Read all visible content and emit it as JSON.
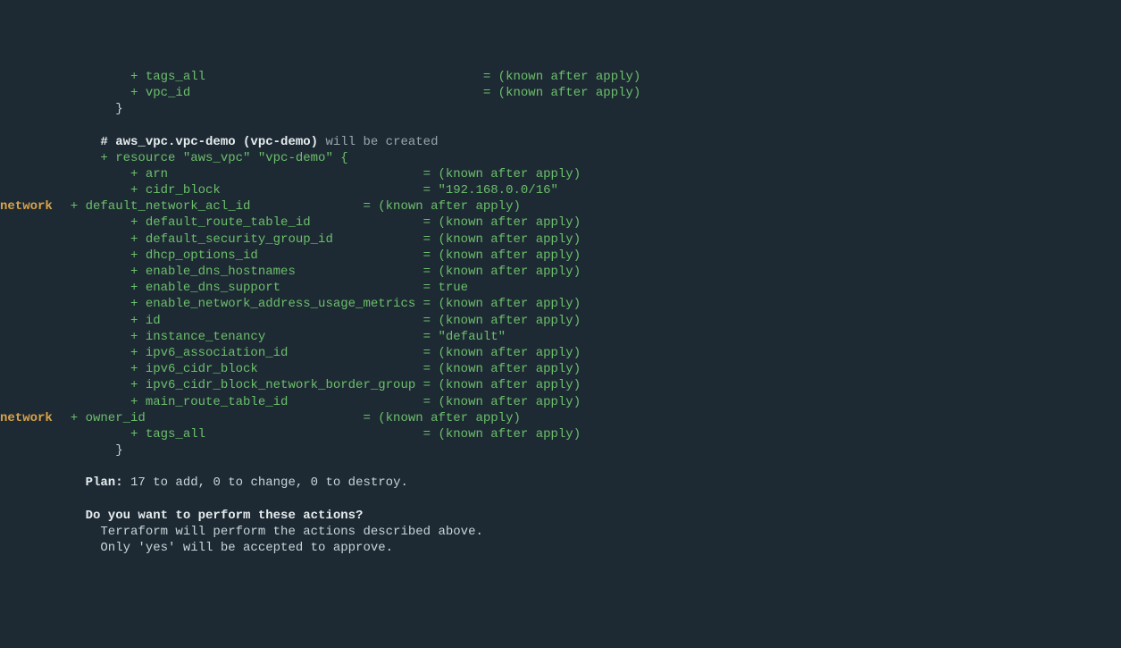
{
  "lines": [
    {
      "gutter": "",
      "text": "          + tags_all                                     = (known after apply)",
      "cls": "plus"
    },
    {
      "gutter": "",
      "text": "          + vpc_id                                       = (known after apply)",
      "cls": "plus"
    },
    {
      "gutter": "",
      "text": "        }",
      "cls": ""
    },
    {
      "gutter": "",
      "text": "",
      "cls": ""
    },
    {
      "gutter": "",
      "text": "",
      "cls": "",
      "segments": [
        {
          "text": "      # aws_vpc.vpc-demo (vpc-demo)",
          "cls": "bold-white"
        },
        {
          "text": " will be created",
          "cls": "comment-gray"
        }
      ]
    },
    {
      "gutter": "",
      "text": "      + resource \"aws_vpc\" \"vpc-demo\" {",
      "cls": "plus"
    },
    {
      "gutter": "",
      "text": "          + arn                                  = (known after apply)",
      "cls": "plus"
    },
    {
      "gutter": "",
      "text": "          + cidr_block                           = \"192.168.0.0/16\"",
      "cls": "plus"
    },
    {
      "gutter": "network",
      "text": "  + default_network_acl_id               = (known after apply)",
      "cls": "plus"
    },
    {
      "gutter": "",
      "text": "          + default_route_table_id               = (known after apply)",
      "cls": "plus"
    },
    {
      "gutter": "",
      "text": "          + default_security_group_id            = (known after apply)",
      "cls": "plus"
    },
    {
      "gutter": "",
      "text": "          + dhcp_options_id                      = (known after apply)",
      "cls": "plus"
    },
    {
      "gutter": "",
      "text": "          + enable_dns_hostnames                 = (known after apply)",
      "cls": "plus"
    },
    {
      "gutter": "",
      "text": "          + enable_dns_support                   = true",
      "cls": "plus"
    },
    {
      "gutter": "",
      "text": "          + enable_network_address_usage_metrics = (known after apply)",
      "cls": "plus"
    },
    {
      "gutter": "",
      "text": "          + id                                   = (known after apply)",
      "cls": "plus"
    },
    {
      "gutter": "",
      "text": "          + instance_tenancy                     = \"default\"",
      "cls": "plus"
    },
    {
      "gutter": "",
      "text": "          + ipv6_association_id                  = (known after apply)",
      "cls": "plus"
    },
    {
      "gutter": "",
      "text": "          + ipv6_cidr_block                      = (known after apply)",
      "cls": "plus"
    },
    {
      "gutter": "",
      "text": "          + ipv6_cidr_block_network_border_group = (known after apply)",
      "cls": "plus"
    },
    {
      "gutter": "",
      "text": "          + main_route_table_id                  = (known after apply)",
      "cls": "plus"
    },
    {
      "gutter": "network",
      "text": "  + owner_id                             = (known after apply)",
      "cls": "plus"
    },
    {
      "gutter": "",
      "text": "          + tags_all                             = (known after apply)",
      "cls": "plus"
    },
    {
      "gutter": "",
      "text": "        }",
      "cls": ""
    },
    {
      "gutter": "",
      "text": "",
      "cls": ""
    },
    {
      "gutter": "",
      "text": "",
      "cls": "",
      "segments": [
        {
          "text": "    Plan:",
          "cls": "bold-white"
        },
        {
          "text": " 17 to add, 0 to change, 0 to destroy.",
          "cls": ""
        }
      ]
    },
    {
      "gutter": "",
      "text": "",
      "cls": ""
    },
    {
      "gutter": "",
      "text": "    Do you want to perform these actions?",
      "cls": "bold-white"
    },
    {
      "gutter": "",
      "text": "      Terraform will perform the actions described above.",
      "cls": ""
    },
    {
      "gutter": "",
      "text": "      Only 'yes' will be accepted to approve.",
      "cls": ""
    }
  ]
}
